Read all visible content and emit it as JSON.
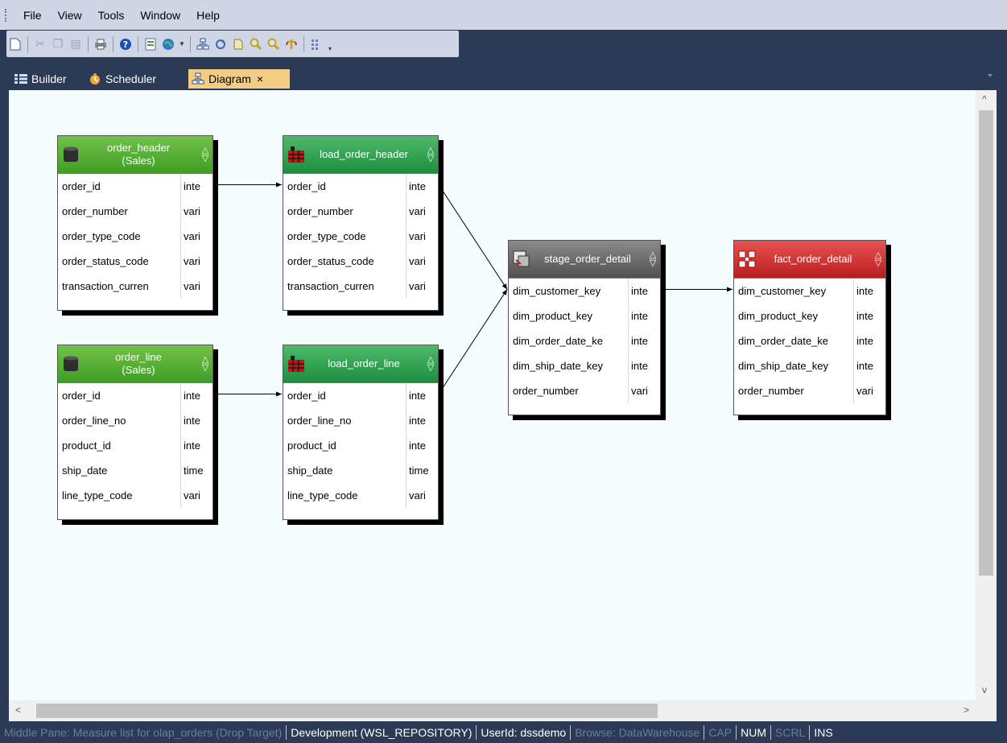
{
  "menu": {
    "items": [
      "File",
      "View",
      "Tools",
      "Window",
      "Help"
    ]
  },
  "toolbar": {
    "icons": [
      "new-icon",
      "cut-icon",
      "copy-icon",
      "paste-icon",
      "print-icon",
      "help-icon",
      "properties-icon",
      "globe-icon",
      "dropdown-icon",
      "diagram-icon",
      "refresh-icon",
      "document-icon",
      "zoom-in-icon",
      "zoom-out-icon",
      "pin-icon",
      "grid-icon",
      "overflow-icon"
    ]
  },
  "tabs": [
    {
      "label": "Builder",
      "icon": "builder-icon"
    },
    {
      "label": "Scheduler",
      "icon": "scheduler-icon"
    },
    {
      "label": "Diagram",
      "icon": "diagram-icon",
      "close": "×",
      "active": true
    }
  ],
  "diagram": {
    "tables": [
      {
        "id": "order_header",
        "title": "order_header\n(Sales)",
        "kind": "src",
        "icon": "database-icon",
        "rows": [
          [
            "order_id",
            "inte"
          ],
          [
            "order_number",
            "vari"
          ],
          [
            "order_type_code",
            "vari"
          ],
          [
            "order_status_code",
            "vari"
          ],
          [
            "transaction_curren",
            "vari"
          ]
        ]
      },
      {
        "id": "load_order_header",
        "title": "load_order_header",
        "kind": "load",
        "icon": "load-table-icon",
        "rows": [
          [
            "order_id",
            "inte"
          ],
          [
            "order_number",
            "vari"
          ],
          [
            "order_type_code",
            "vari"
          ],
          [
            "order_status_code",
            "vari"
          ],
          [
            "transaction_curren",
            "vari"
          ]
        ]
      },
      {
        "id": "order_line",
        "title": "order_line\n(Sales)",
        "kind": "src",
        "icon": "database-icon",
        "rows": [
          [
            "order_id",
            "inte"
          ],
          [
            "order_line_no",
            "inte"
          ],
          [
            "product_id",
            "inte"
          ],
          [
            "ship_date",
            "time"
          ],
          [
            "line_type_code",
            "vari"
          ]
        ]
      },
      {
        "id": "load_order_line",
        "title": "load_order_line",
        "kind": "load",
        "icon": "load-table-icon",
        "rows": [
          [
            "order_id",
            "inte"
          ],
          [
            "order_line_no",
            "inte"
          ],
          [
            "product_id",
            "inte"
          ],
          [
            "ship_date",
            "time"
          ],
          [
            "line_type_code",
            "vari"
          ]
        ]
      },
      {
        "id": "stage_order_detail",
        "title": "stage_order_detail",
        "kind": "stage",
        "icon": "stage-table-icon",
        "rows": [
          [
            "dim_customer_key",
            "inte"
          ],
          [
            "dim_product_key",
            "inte"
          ],
          [
            "dim_order_date_ke",
            "inte"
          ],
          [
            "dim_ship_date_key",
            "inte"
          ],
          [
            "order_number",
            "vari"
          ]
        ]
      },
      {
        "id": "fact_order_detail",
        "title": "fact_order_detail",
        "kind": "fact",
        "icon": "fact-table-icon",
        "rows": [
          [
            "dim_customer_key",
            "inte"
          ],
          [
            "dim_product_key",
            "inte"
          ],
          [
            "dim_order_date_ke",
            "inte"
          ],
          [
            "dim_ship_date_key",
            "inte"
          ],
          [
            "order_number",
            "vari"
          ]
        ]
      }
    ]
  },
  "status": [
    {
      "text": "Middle Pane: Measure list for olap_orders (Drop Target)",
      "enabled": false
    },
    {
      "text": "Development (WSL_REPOSITORY)",
      "enabled": true
    },
    {
      "text": "UserId: dssdemo",
      "enabled": true
    },
    {
      "text": "Browse: DataWarehouse",
      "enabled": false
    },
    {
      "text": "CAP",
      "enabled": false
    },
    {
      "text": "NUM",
      "enabled": true
    },
    {
      "text": "SCRL",
      "enabled": false
    },
    {
      "text": "INS",
      "enabled": true
    }
  ],
  "colors": {
    "window": "#2b3a55",
    "menubar": "#cfd6e5",
    "canvas": "#f5fdff",
    "active_tab": "#f5cc84",
    "src_header": "#4fa82e",
    "load_header": "#2a9a4b",
    "stage_header": "#5e5e5e",
    "fact_header": "#cf2f2f"
  }
}
